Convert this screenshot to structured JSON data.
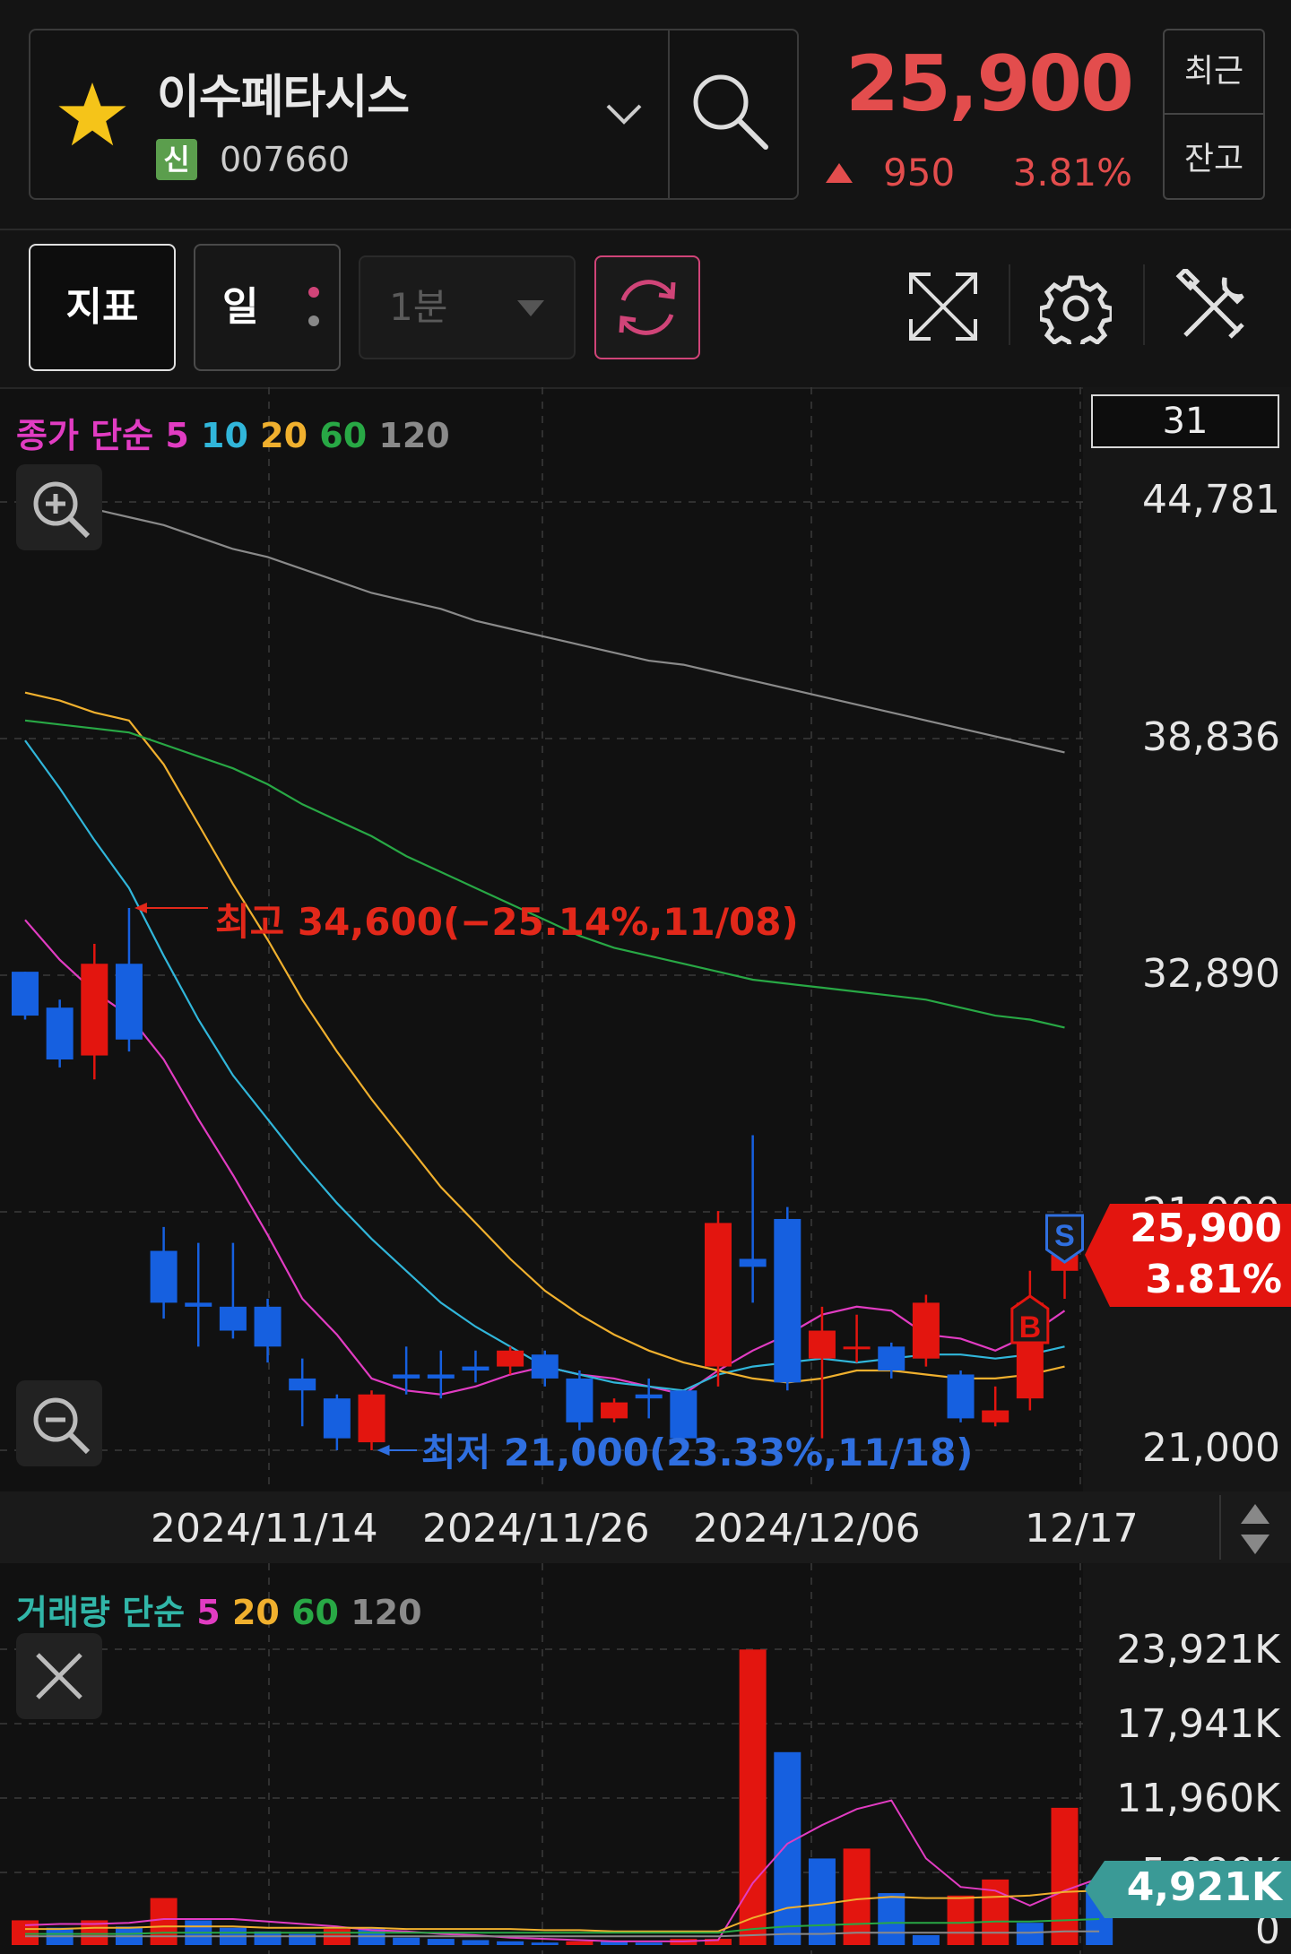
{
  "header": {
    "stock_name": "이수페타시스",
    "credit_badge": "신",
    "stock_code": "007660",
    "price": "25,900",
    "change_abs": "950",
    "change_pct": "3.81%",
    "side_recent": "최근",
    "side_balance": "잔고",
    "colors": {
      "up": "#e34d4d",
      "favorite_star": "#f5c419"
    }
  },
  "toolbar": {
    "indicator_label": "지표",
    "period_label": "일",
    "interval_label": "1분",
    "icons": [
      "refresh-icon",
      "fullscreen-icon",
      "gear-icon",
      "tools-icon"
    ]
  },
  "price_chart": {
    "legend": {
      "prefix": "종가 단순",
      "periods": [
        "5",
        "10",
        "20",
        "60",
        "120"
      ]
    },
    "count": "31",
    "y_labels": [
      "44,781",
      "38,836",
      "32,890",
      "21,000"
    ],
    "partial_label": "26,945",
    "x_labels": [
      "2024/11/14",
      "2024/11/26",
      "2024/12/06",
      "12/17"
    ],
    "high_label": "최고 34,600(−25.14%,11/08)",
    "low_label": "최저 21,000(23.33%,11/18)",
    "tag_price": "25,900",
    "tag_pct": "3.81%",
    "signal_sell": "S",
    "signal_buy": "B"
  },
  "volume_chart": {
    "legend": {
      "prefix": "거래량 단순",
      "periods": [
        "5",
        "20",
        "60",
        "120"
      ]
    },
    "y_labels": [
      "23,921K",
      "17,941K",
      "11,960K",
      "0"
    ],
    "partial_label": "5,980K",
    "tag_value": "4,921K"
  },
  "chart_data": [
    {
      "type": "candlestick",
      "title": "종가 단순 5 10 20 60 120",
      "ylim": [
        21000,
        44781
      ],
      "x_ticks": [
        "2024/11/14",
        "2024/11/26",
        "2024/12/06",
        "12/17"
      ],
      "candles": [
        {
          "o": 33000,
          "c": 31900,
          "h": 33000,
          "l": 31800
        },
        {
          "o": 32100,
          "c": 30800,
          "h": 32300,
          "l": 30600
        },
        {
          "o": 30900,
          "c": 33200,
          "h": 33700,
          "l": 30300
        },
        {
          "o": 33200,
          "c": 31300,
          "h": 34600,
          "l": 31000
        },
        {
          "o": 26000,
          "c": 24700,
          "h": 26600,
          "l": 24300
        },
        {
          "o": 24700,
          "c": 24600,
          "h": 26200,
          "l": 23600
        },
        {
          "o": 24600,
          "c": 24000,
          "h": 26200,
          "l": 23800
        },
        {
          "o": 24600,
          "c": 23600,
          "h": 24800,
          "l": 23200
        },
        {
          "o": 22800,
          "c": 22500,
          "h": 23300,
          "l": 21600
        },
        {
          "o": 22300,
          "c": 21300,
          "h": 22400,
          "l": 21000
        },
        {
          "o": 21200,
          "c": 22400,
          "h": 22500,
          "l": 21000
        },
        {
          "o": 22900,
          "c": 22800,
          "h": 23600,
          "l": 22400
        },
        {
          "o": 22900,
          "c": 22800,
          "h": 23500,
          "l": 22300
        },
        {
          "o": 23100,
          "c": 23000,
          "h": 23500,
          "l": 22700
        },
        {
          "o": 23100,
          "c": 23500,
          "h": 23600,
          "l": 22900
        },
        {
          "o": 23400,
          "c": 22800,
          "h": 23500,
          "l": 22600
        },
        {
          "o": 22800,
          "c": 21700,
          "h": 23000,
          "l": 21500
        },
        {
          "o": 21800,
          "c": 22200,
          "h": 22300,
          "l": 21700
        },
        {
          "o": 22400,
          "c": 22300,
          "h": 22800,
          "l": 21800
        },
        {
          "o": 22500,
          "c": 21300,
          "h": 22500,
          "l": 21100
        },
        {
          "o": 23100,
          "c": 26700,
          "h": 27000,
          "l": 22600
        },
        {
          "o": 25800,
          "c": 25600,
          "h": 28900,
          "l": 24700
        },
        {
          "o": 26800,
          "c": 22700,
          "h": 27100,
          "l": 22500
        },
        {
          "o": 23300,
          "c": 24000,
          "h": 24600,
          "l": 21300
        },
        {
          "o": 23600,
          "c": 23600,
          "h": 24400,
          "l": 23200
        },
        {
          "o": 23600,
          "c": 23000,
          "h": 23700,
          "l": 22800
        },
        {
          "o": 23300,
          "c": 24700,
          "h": 24900,
          "l": 23100
        },
        {
          "o": 22900,
          "c": 21800,
          "h": 23000,
          "l": 21700
        },
        {
          "o": 21700,
          "c": 22000,
          "h": 22600,
          "l": 21600
        },
        {
          "o": 22300,
          "c": 24700,
          "h": 25500,
          "l": 22000
        },
        {
          "o": 25500,
          "c": 25900,
          "h": 26400,
          "l": 24800
        }
      ],
      "series": [
        {
          "name": "5",
          "color": "#e13cc2",
          "values": [
            34300,
            33300,
            32500,
            31900,
            30800,
            29300,
            27900,
            26400,
            24800,
            23900,
            22800,
            22500,
            22400,
            22600,
            22900,
            23100,
            22900,
            22800,
            22600,
            22400,
            23000,
            23500,
            23900,
            24400,
            24600,
            24500,
            23900,
            23800,
            23500,
            23900,
            24500
          ]
        },
        {
          "name": "10",
          "color": "#31b6da",
          "values": [
            38800,
            37600,
            36300,
            35100,
            33400,
            31800,
            30400,
            29300,
            28200,
            27200,
            26300,
            25500,
            24700,
            24100,
            23600,
            23100,
            22900,
            22700,
            22600,
            22500,
            22900,
            23100,
            23200,
            23300,
            23200,
            23300,
            23400,
            23400,
            23300,
            23400,
            23600
          ]
        },
        {
          "name": "20",
          "color": "#f0b02e",
          "values": [
            40000,
            39800,
            39500,
            39300,
            38200,
            36700,
            35200,
            33800,
            32300,
            31000,
            29800,
            28700,
            27600,
            26700,
            25800,
            25000,
            24400,
            23900,
            23500,
            23200,
            23000,
            22800,
            22700,
            22800,
            23000,
            23000,
            22900,
            22800,
            22800,
            22900,
            23100
          ]
        },
        {
          "name": "60",
          "color": "#28a845",
          "values": [
            39300,
            39200,
            39100,
            39000,
            38700,
            38400,
            38100,
            37700,
            37200,
            36800,
            36400,
            35900,
            35500,
            35100,
            34700,
            34300,
            33900,
            33600,
            33400,
            33200,
            33000,
            32800,
            32700,
            32600,
            32500,
            32400,
            32300,
            32100,
            31900,
            31800,
            31600
          ]
        },
        {
          "name": "120",
          "color": "#8a8a8a",
          "values": [
            44800,
            44700,
            44600,
            44400,
            44200,
            43900,
            43600,
            43400,
            43100,
            42800,
            42500,
            42300,
            42100,
            41800,
            41600,
            41400,
            41200,
            41000,
            40800,
            40700,
            40500,
            40300,
            40100,
            39900,
            39700,
            39500,
            39300,
            39100,
            38900,
            38700,
            38500
          ]
        }
      ],
      "annotations": [
        "최고 34,600(−25.14%,11/08)",
        "최저 21,000(23.33%,11/18)"
      ]
    },
    {
      "type": "bar",
      "title": "거래량 단순 5 20 60 120",
      "ylim": [
        0,
        23921
      ],
      "unit": "K",
      "values": [
        2000,
        1400,
        2000,
        1500,
        3800,
        2000,
        1400,
        1100,
        900,
        1300,
        1400,
        600,
        500,
        400,
        300,
        200,
        300,
        300,
        200,
        500,
        500,
        23900,
        15600,
        7000,
        7800,
        4200,
        800,
        4000,
        5300,
        1800,
        11100,
        4900
      ],
      "up": [
        true,
        false,
        true,
        false,
        true,
        false,
        false,
        false,
        false,
        true,
        false,
        false,
        false,
        false,
        false,
        false,
        true,
        false,
        false,
        true,
        true,
        true,
        false,
        false,
        true,
        false,
        false,
        true,
        true,
        false,
        true,
        false
      ],
      "series": [
        {
          "name": "5",
          "color": "#e13cc2",
          "values": [
            1600,
            1700,
            1700,
            1800,
            2100,
            2100,
            2100,
            1900,
            1700,
            1500,
            1200,
            1100,
            900,
            800,
            600,
            500,
            400,
            300,
            300,
            300,
            400,
            5000,
            8200,
            9700,
            11000,
            11700,
            7000,
            4700,
            4400,
            3200,
            4400,
            5400
          ]
        },
        {
          "name": "20",
          "color": "#f0b02e",
          "values": [
            1300,
            1300,
            1400,
            1400,
            1500,
            1500,
            1500,
            1400,
            1400,
            1400,
            1400,
            1300,
            1300,
            1300,
            1300,
            1200,
            1200,
            1100,
            1100,
            1100,
            1100,
            2200,
            3000,
            3300,
            3700,
            3900,
            3800,
            3800,
            3900,
            4000,
            4300,
            4400
          ]
        },
        {
          "name": "60",
          "color": "#28a845",
          "values": [
            900,
            900,
            900,
            900,
            1000,
            1000,
            1000,
            1000,
            1000,
            1000,
            1000,
            1000,
            1000,
            1000,
            1000,
            1000,
            1000,
            1000,
            1000,
            1000,
            1000,
            1300,
            1500,
            1600,
            1700,
            1800,
            1800,
            1800,
            1900,
            1900,
            2000,
            2100
          ]
        },
        {
          "name": "120",
          "color": "#8a8a8a",
          "values": [
            700,
            700,
            700,
            700,
            700,
            700,
            700,
            700,
            700,
            700,
            700,
            700,
            700,
            700,
            700,
            700,
            700,
            700,
            700,
            700,
            700,
            800,
            900,
            900,
            1000,
            1000,
            1000,
            1000,
            1000,
            1000,
            1100,
            1100
          ]
        }
      ]
    }
  ]
}
